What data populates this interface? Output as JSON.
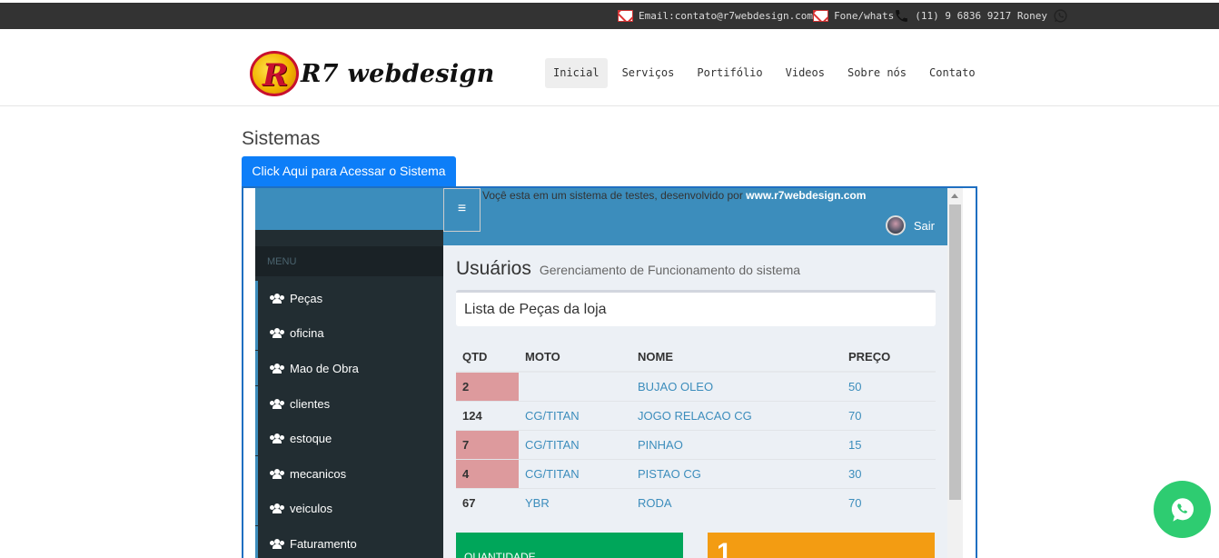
{
  "topbar": {
    "email_label": "Email:contato@r7webdesign.com",
    "phone_label": "Fone/whats",
    "phone_number": "(11) 9 6836 9217 Roney"
  },
  "header": {
    "logo_letter": "R",
    "logo_text": "R7 webdesign",
    "nav": [
      "Inicial",
      "Serviços",
      "Portifólio",
      "Videos",
      "Sobre nós",
      "Contato"
    ]
  },
  "page": {
    "section_title": "Sistemas",
    "access_button": "Click Aqui para Acessar o Sistema"
  },
  "embedded": {
    "notice_text": "Voçê esta em um sistema de testes, desenvolvido por",
    "notice_link": "www.r7webdesign.com",
    "toggle_icon": "≡",
    "logout_label": "Sair",
    "menu_header": "MENU",
    "menu_items": [
      "Peças",
      "oficina",
      "Mao de Obra",
      "clientes",
      "estoque",
      "mecanicos",
      "veiculos",
      "Faturamento"
    ],
    "page_title": "Usuários",
    "page_subtitle": "Gerenciamento de Funcionamento do sistema",
    "box_title": "Lista de Peças da loja",
    "table": {
      "headers": [
        "QTD",
        "MOTO",
        "NOME",
        "PREÇO"
      ],
      "rows": [
        {
          "qtd": "2",
          "moto": "",
          "nome": "BUJAO OLEO",
          "preco": "50",
          "low": true
        },
        {
          "qtd": "124",
          "moto": "CG/TITAN",
          "nome": "JOGO RELACAO CG",
          "preco": "70",
          "low": false
        },
        {
          "qtd": "7",
          "moto": "CG/TITAN",
          "nome": "PINHAO",
          "preco": "15",
          "low": true
        },
        {
          "qtd": "4",
          "moto": "CG/TITAN",
          "nome": "PISTAO CG",
          "preco": "30",
          "low": true
        },
        {
          "qtd": "67",
          "moto": "YBR",
          "nome": "RODA",
          "preco": "70",
          "low": false
        }
      ]
    },
    "tile_green_label": "QUANTIDADE",
    "tile_orange_value": "1"
  },
  "colors": {
    "accent": "#3c8dbc",
    "sidebar": "#222d32",
    "low_stock": "#dd9a9d",
    "whatsapp": "#2ecc71"
  }
}
